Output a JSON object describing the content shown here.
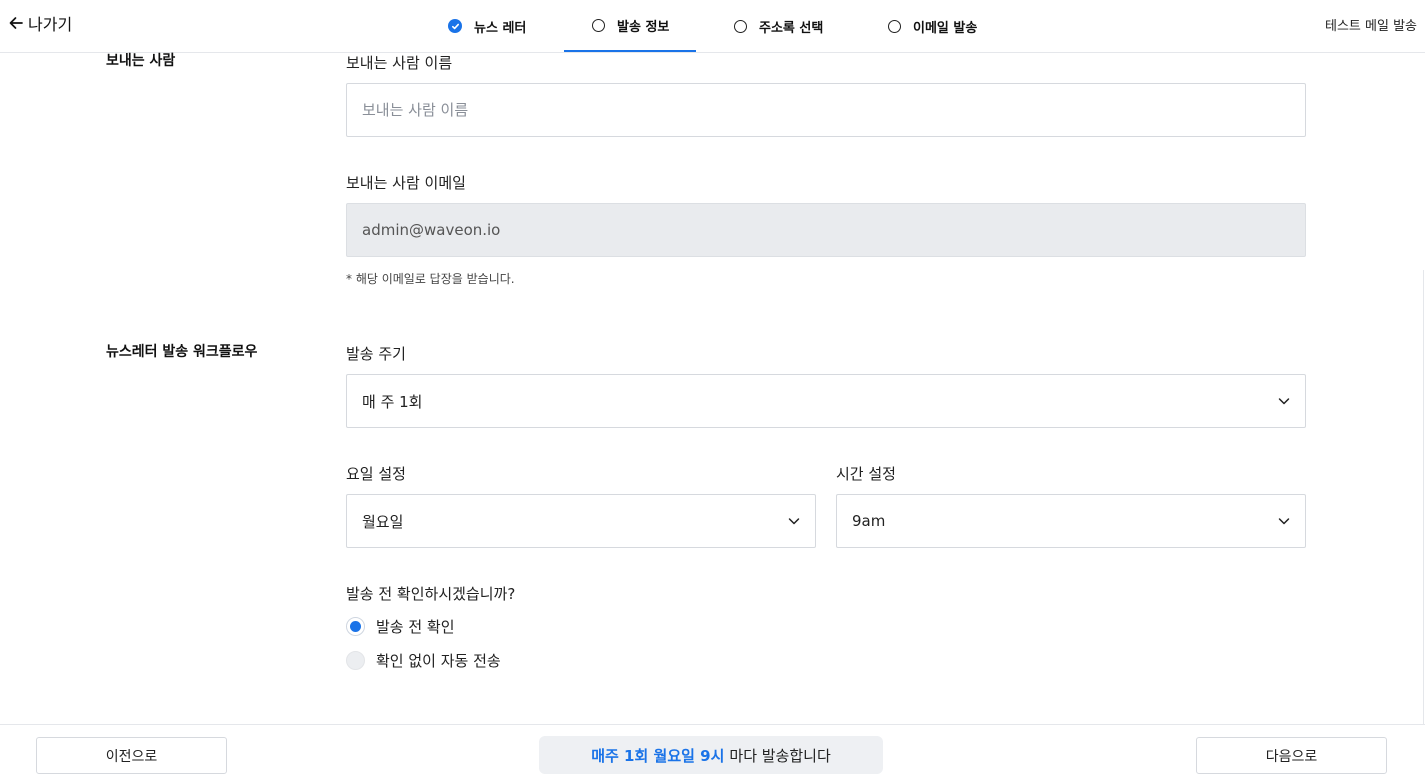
{
  "header": {
    "back_label": "나가기",
    "steps": [
      {
        "label": "뉴스 레터",
        "state": "done"
      },
      {
        "label": "발송 정보",
        "state": "active"
      },
      {
        "label": "주소록 선택",
        "state": "todo"
      },
      {
        "label": "이메일 발송",
        "state": "todo"
      }
    ],
    "test_mail_label": "테스트 메일 발송",
    "accent_color": "#1a73e8"
  },
  "sender": {
    "section_title": "보내는 사람",
    "name_label": "보내는 사람 이름",
    "name_placeholder": "보내는 사람 이름",
    "name_value": "",
    "email_label": "보내는 사람 이메일",
    "email_value": "admin@waveon.io",
    "email_hint": "* 해당 이메일로 답장을 받습니다."
  },
  "workflow": {
    "section_title": "뉴스레터 발송 워크플로우",
    "cycle_label": "발송 주기",
    "cycle_value": "매 주 1회",
    "day_label": "요일 설정",
    "day_value": "월요일",
    "time_label": "시간 설정",
    "time_value": "9am",
    "confirm_question": "발송 전 확인하시겠습니까?",
    "options": [
      {
        "label": "발송 전 확인",
        "selected": true
      },
      {
        "label": "확인 없이 자동 전송",
        "selected": false
      }
    ]
  },
  "footer": {
    "prev_label": "이전으로",
    "summary_highlight": "매주 1회 월요일 9시",
    "summary_rest": "마다 발송합니다",
    "next_label": "다음으로"
  }
}
